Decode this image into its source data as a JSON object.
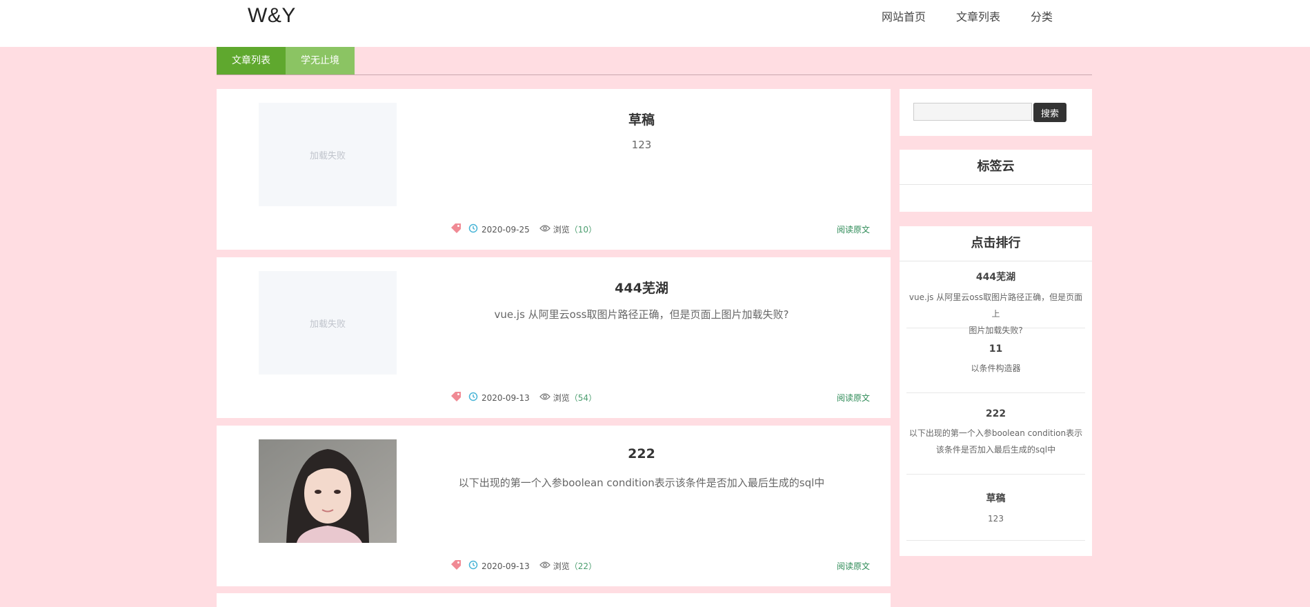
{
  "header": {
    "logo": "W&Y",
    "nav": [
      "网站首页",
      "文章列表",
      "分类"
    ]
  },
  "tabs": [
    "文章列表",
    "学无止境"
  ],
  "articles": [
    {
      "title": "草稿",
      "excerpt": "123",
      "thumb_text": "加载失败",
      "date": "2020-09-25",
      "views_label": "浏览",
      "views": "（10）",
      "read_more": "阅读原文"
    },
    {
      "title": "444芜湖",
      "excerpt": "vue.js 从阿里云oss取图片路径正确，但是页面上图片加载失败?",
      "thumb_text": "加载失败",
      "date": "2020-09-13",
      "views_label": "浏览",
      "views": "（54）",
      "read_more": "阅读原文"
    },
    {
      "title": "222",
      "excerpt": "以下出现的第一个入参boolean condition表示该条件是否加入最后生成的sql中",
      "thumb_text": "",
      "date": "2020-09-13",
      "views_label": "浏览",
      "views": "（22）",
      "read_more": "阅读原文"
    }
  ],
  "sidebar": {
    "search_button": "搜索",
    "search_placeholder": "",
    "tag_cloud_title": "标签云",
    "ranking_title": "点击排行",
    "ranking": [
      {
        "title": "444芜湖",
        "desc_line1": "vue.js 从阿里云oss取图片路径正确，但是页面上",
        "desc_line2": "图片加载失败?"
      },
      {
        "title": "11",
        "desc_line1": "以条件构造器",
        "desc_line2": ""
      },
      {
        "title": "222",
        "desc_line1": "以下出现的第一个入参boolean condition表示",
        "desc_line2": "该条件是否加入最后生成的sql中"
      },
      {
        "title": "草稿",
        "desc_line1": "123",
        "desc_line2": ""
      }
    ]
  },
  "colors": {
    "page_bg": "#ffdde2",
    "tab_active": "#5fa82e",
    "tab_alt": "#8bc463",
    "read_more": "#2e8b57"
  }
}
